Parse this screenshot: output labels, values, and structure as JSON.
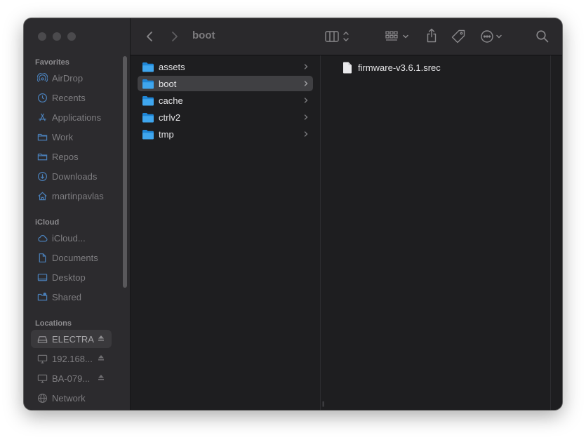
{
  "toolbar": {
    "title": "boot",
    "icons": [
      "chevron-left-icon",
      "chevron-right-icon",
      "column-view-icon",
      "group-grid-icon",
      "share-icon",
      "tag-icon",
      "more-icon",
      "search-icon"
    ]
  },
  "sidebar": {
    "sections": {
      "favorites": "Favorites",
      "icloud": "iCloud",
      "locations": "Locations"
    },
    "favorites": [
      {
        "label": "AirDrop",
        "icon": "airdrop-icon"
      },
      {
        "label": "Recents",
        "icon": "clock-icon"
      },
      {
        "label": "Applications",
        "icon": "applications-icon"
      },
      {
        "label": "Work",
        "icon": "folder-icon"
      },
      {
        "label": "Repos",
        "icon": "folder-icon"
      },
      {
        "label": "Downloads",
        "icon": "download-icon"
      },
      {
        "label": "martinpavlas",
        "icon": "home-icon"
      }
    ],
    "icloud": [
      {
        "label": "iCloud...",
        "icon": "cloud-icon"
      },
      {
        "label": "Documents",
        "icon": "document-icon"
      },
      {
        "label": "Desktop",
        "icon": "desktop-icon"
      },
      {
        "label": "Shared",
        "icon": "shared-folder-icon"
      }
    ],
    "locations": [
      {
        "label": "ELECTRA",
        "icon": "drive-icon",
        "eject": true,
        "selected": true
      },
      {
        "label": "192.168...",
        "icon": "monitor-icon",
        "eject": true
      },
      {
        "label": "BA-079...",
        "icon": "monitor-icon",
        "eject": true
      },
      {
        "label": "Network",
        "icon": "network-icon"
      }
    ]
  },
  "column1": {
    "items": [
      {
        "label": "assets",
        "selected": false
      },
      {
        "label": "boot",
        "selected": true
      },
      {
        "label": "cache",
        "selected": false
      },
      {
        "label": "ctrlv2",
        "selected": false
      },
      {
        "label": "tmp",
        "selected": false
      }
    ]
  },
  "column2": {
    "items": [
      {
        "label": "firmware-v3.6.1.srec"
      }
    ]
  },
  "colors": {
    "folder_blue": "#3fa6ee",
    "window_bg": "#1e1e20",
    "sidebar_bg": "#2c2b2e",
    "selection": "#404043"
  }
}
